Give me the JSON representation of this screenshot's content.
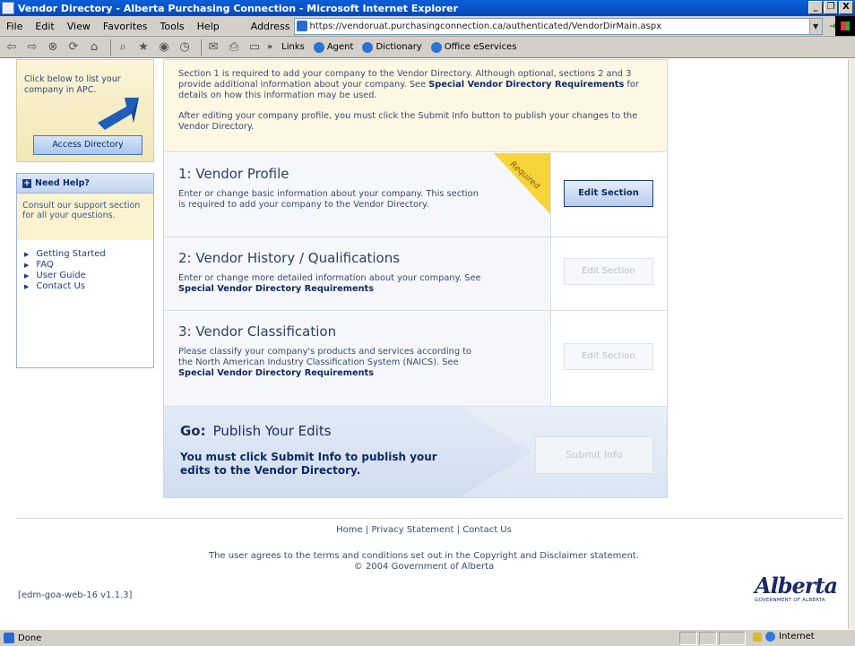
{
  "window": {
    "title": "Vendor Directory - Alberta Purchasing Connection - Microsoft Internet Explorer",
    "controls": [
      "_",
      "❐",
      "X"
    ]
  },
  "menu": {
    "items": [
      "File",
      "Edit",
      "View",
      "Favorites",
      "Tools",
      "Help"
    ],
    "address_label": "Address",
    "url": "https://vendoruat.purchasingconnection.ca/authenticated/VendorDirMain.aspx",
    "go_label": "Go"
  },
  "toolbar": {
    "chevron": "»",
    "links_label": "Links",
    "links": [
      "Agent",
      "Dictionary",
      "Office eServices"
    ]
  },
  "sidebar": {
    "promo_text": "Click below to list your company in APC.",
    "access_button": "Access Directory",
    "help_title": "Need Help?",
    "help_sub": "Consult our support section for all your questions.",
    "links": [
      "Getting Started",
      "FAQ",
      "User Guide",
      "Contact Us"
    ]
  },
  "intro": {
    "p1_a": "Section 1 is required to add your company to the Vendor Directory. Although optional, sections 2 and 3 provide additional information about your company. See ",
    "p1_link": "Special Vendor Directory Requirements",
    "p1_b": " for details on how this information may be used.",
    "p2": "After editing your company profile, you must click the Submit Info button to publish your changes to the Vendor Directory."
  },
  "sections": [
    {
      "title": "1: Vendor Profile",
      "desc": "Enter or change basic information about your company. This section is required to add your company to the Vendor Directory.",
      "button": "Edit Section",
      "badge": "Required"
    },
    {
      "title": "2: Vendor History / Qualifications",
      "desc": "Enter or change more detailed information about your company. See ",
      "link": "Special Vendor Directory Requirements",
      "button": "Edit Section"
    },
    {
      "title": "3: Vendor Classification",
      "desc": "Please classify your company's products and services according to the North American Industry Classification System (NAICS). See ",
      "link": "Special Vendor Directory Requirements",
      "button": "Edit Section"
    }
  ],
  "go": {
    "label": "Go:",
    "title": "Publish Your Edits",
    "message": "You must click Submit Info to publish your edits to the Vendor Directory.",
    "button": "Submit Info"
  },
  "footer": {
    "links": [
      "Home",
      "Privacy Statement",
      "Contact Us"
    ],
    "separator": "|",
    "terms": "The user agrees to the terms and conditions set out in the Copyright and Disclaimer statement.",
    "copyright": "© 2004 Government of Alberta",
    "version": "[edm-goa-web-16 v1.1.3]",
    "logo_word": "Alberta",
    "logo_sub": "GOVERNMENT OF ALBERTA"
  },
  "status": {
    "text": "Done",
    "zone": "Internet"
  }
}
